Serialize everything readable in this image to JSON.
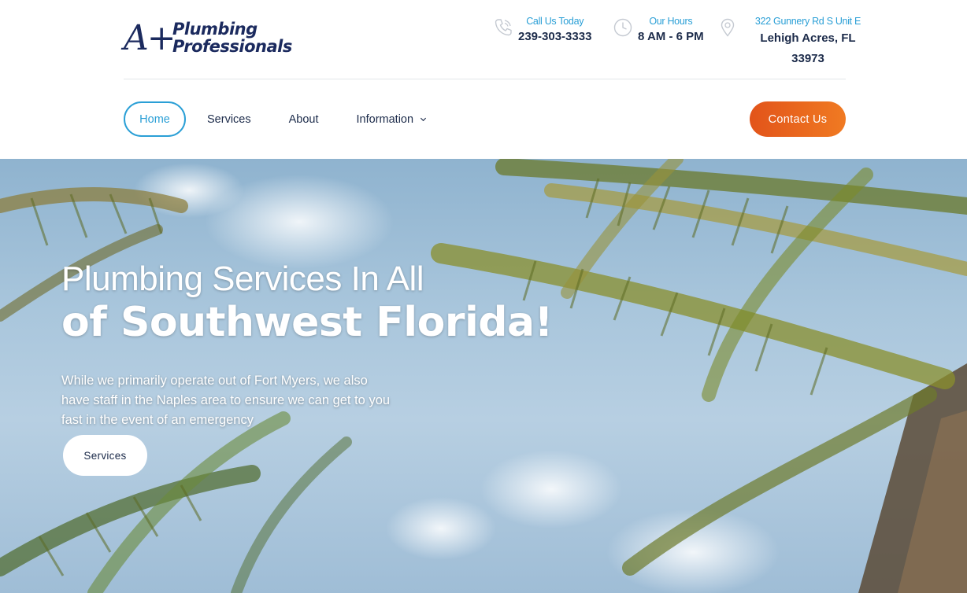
{
  "logo": {
    "mark": "A+",
    "line1": "Plumbing",
    "line2": "Professionals"
  },
  "contact_info": {
    "phone": {
      "label": "Call Us Today",
      "value": "239-303-3333",
      "icon": "phone-icon"
    },
    "hours": {
      "label": "Our Hours",
      "value": "8 AM - 6 PM",
      "icon": "clock-icon"
    },
    "address": {
      "label": "322 Gunnery Rd S Unit E",
      "value": "Lehigh Acres, FL 33973",
      "icon": "map-pin-icon"
    }
  },
  "nav": {
    "items": [
      {
        "label": "Home",
        "active": true
      },
      {
        "label": "Services"
      },
      {
        "label": "About"
      },
      {
        "label": "Information",
        "has_dropdown": true
      }
    ],
    "cta": "Contact Us"
  },
  "hero": {
    "title_line1": "Plumbing Services In All",
    "title_line2": "of Southwest Florida!",
    "subtitle": "While we primarily operate out of Fort Myers, we also have staff in the Naples area to ensure we can get to you fast in the event of an emergency",
    "button": "Services"
  },
  "colors": {
    "accent": "#2a9fd6",
    "brand_navy": "#1b2a5e",
    "cta_orange": "#e2541a"
  }
}
